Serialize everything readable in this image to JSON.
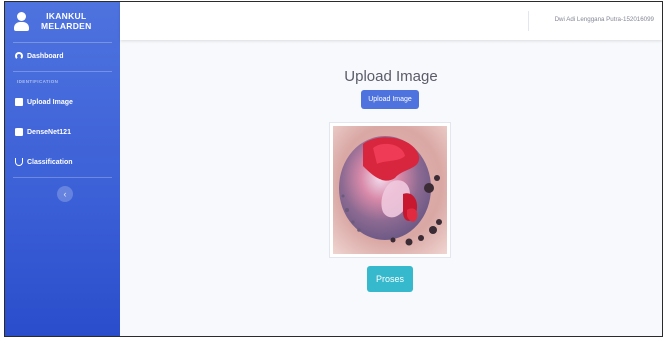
{
  "brand": {
    "line1": "IKANKUL",
    "line2": "MELARDEN"
  },
  "sidebar": {
    "dashboard": "Dashboard",
    "section_heading": "IDENTIFICATION",
    "items": [
      {
        "label": "Upload Image",
        "icon": "image-icon"
      },
      {
        "label": "DenseNet121",
        "icon": "database-icon"
      },
      {
        "label": "Classification",
        "icon": "stethoscope-icon"
      }
    ],
    "toggle_glyph": "‹"
  },
  "topbar": {
    "user_name": "Dwi Adi Lenggana Putra-152016099"
  },
  "main": {
    "title": "Upload Image",
    "upload_button": "Upload Image",
    "process_button": "Proses"
  },
  "colors": {
    "primary": "#4e73df",
    "info": "#36b9cc",
    "background": "#f8f9fc"
  }
}
